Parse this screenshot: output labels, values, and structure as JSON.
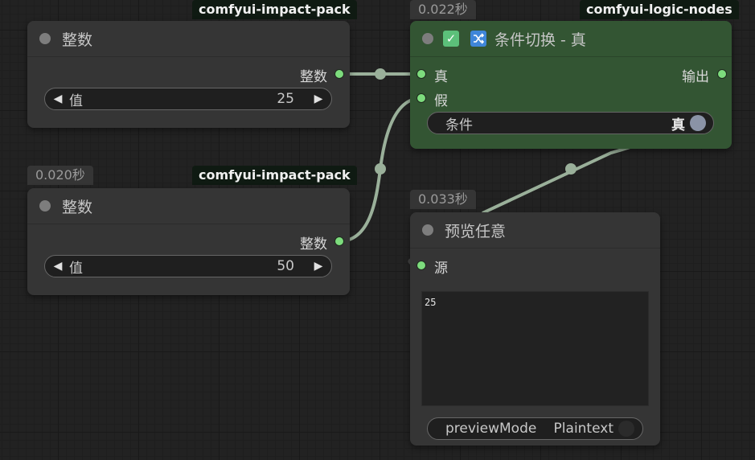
{
  "nodes": {
    "int_a": {
      "pack": "comfyui-impact-pack",
      "title": "整数",
      "output": "整数",
      "widget": {
        "label": "值",
        "value": "25"
      }
    },
    "int_b": {
      "time": "0.020秒",
      "pack": "comfyui-impact-pack",
      "title": "整数",
      "output": "整数",
      "widget": {
        "label": "值",
        "value": "50"
      }
    },
    "switch": {
      "time": "0.022秒",
      "pack": "comfyui-logic-nodes",
      "title": "条件切换 - 真",
      "inputs": [
        "真",
        "假"
      ],
      "output": "输出",
      "widget": {
        "label": "条件",
        "value": "真"
      },
      "checked": true
    },
    "preview": {
      "time": "0.033秒",
      "title": "预览任意",
      "input": "源",
      "text": "25",
      "widget": {
        "label": "previewMode",
        "value": "Plaintext"
      }
    }
  },
  "colors": {
    "node": "#353535",
    "node_active": "#335533",
    "slot": "#7ddc7d",
    "wire": "#9ab09a",
    "background": "#222222"
  },
  "icons": [
    "collapse-dot",
    "checkbox-check",
    "shuffle-icon",
    "arrow-left",
    "arrow-right",
    "toggle-knob"
  ]
}
